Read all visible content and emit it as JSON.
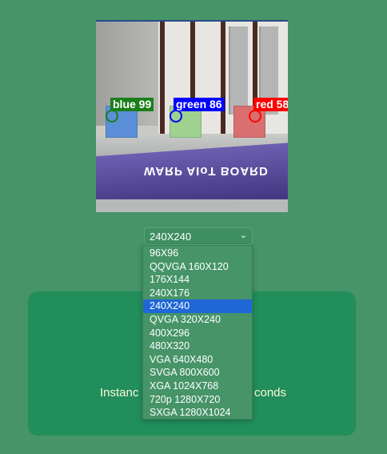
{
  "camera": {
    "banner_text": "WARP AIoT BOARD",
    "detections": [
      {
        "label": "blue 99",
        "color": "#1b7f1b",
        "box_color": "#5b8fd8"
      },
      {
        "label": "green 86",
        "color": "#0000ff",
        "box_color": "#9fd28f"
      },
      {
        "label": "red 58",
        "color": "#ff0000",
        "box_color": "#d97070"
      }
    ]
  },
  "resolution_select": {
    "value": "240X240",
    "options": [
      "96X96",
      "QQVGA 160X120",
      "176X144",
      "240X176",
      "240X240",
      "QVGA 320X240",
      "400X296",
      "480X320",
      "VGA 640X480",
      "SVGA 800X600",
      "XGA 1024X768",
      "720p 1280X720",
      "SXGA 1280X1024"
    ],
    "selected_index": 4
  },
  "card": {
    "text_left": "Instanc",
    "text_right": "conds"
  },
  "colors": {
    "background": "#469468",
    "card": "#218e5c",
    "selected": "#1f66d6"
  }
}
